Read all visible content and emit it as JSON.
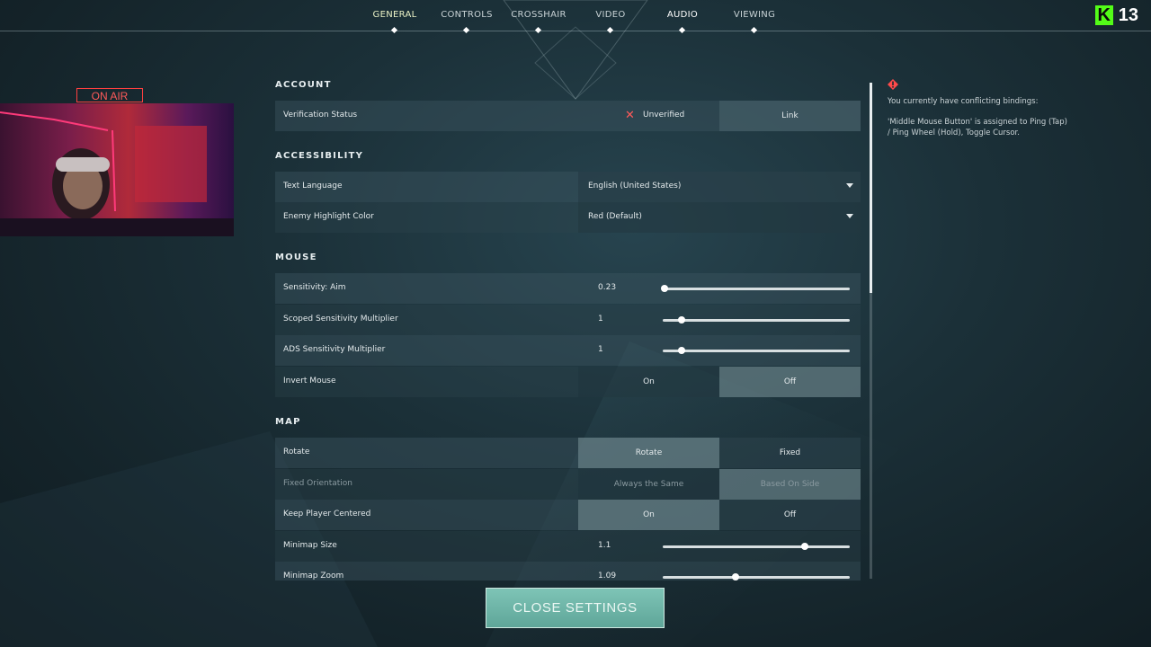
{
  "nav": {
    "tabs": [
      {
        "label": "GENERAL"
      },
      {
        "label": "CONTROLS"
      },
      {
        "label": "CROSSHAIR"
      },
      {
        "label": "VIDEO"
      },
      {
        "label": "AUDIO"
      },
      {
        "label": "VIEWING"
      }
    ],
    "active_tab": "GENERAL"
  },
  "brand": {
    "logo_letter": "K",
    "count": "13"
  },
  "overlay": {
    "on_air": "ON AIR"
  },
  "sections": {
    "account": "ACCOUNT",
    "accessibility": "ACCESSIBILITY",
    "mouse": "MOUSE",
    "map": "MAP"
  },
  "account": {
    "verification_label": "Verification Status",
    "verification_value": "Unverified",
    "link_label": "Link"
  },
  "accessibility": {
    "text_language_label": "Text Language",
    "text_language_value": "English (United States)",
    "enemy_color_label": "Enemy Highlight Color",
    "enemy_color_value": "Red (Default)"
  },
  "mouse": {
    "sens_aim_label": "Sensitivity: Aim",
    "sens_aim_value": "0.23",
    "sens_aim_fraction": 0.01,
    "scoped_label": "Scoped Sensitivity Multiplier",
    "scoped_value": "1",
    "scoped_fraction": 0.1,
    "ads_label": "ADS Sensitivity Multiplier",
    "ads_value": "1",
    "ads_fraction": 0.1,
    "invert_label": "Invert Mouse",
    "invert_on": "On",
    "invert_off": "Off",
    "invert_selected": "Off"
  },
  "map": {
    "rotate_label": "Rotate",
    "rotate_opt1": "Rotate",
    "rotate_opt2": "Fixed",
    "rotate_selected": "Rotate",
    "fixed_orient_label": "Fixed Orientation",
    "fixed_orient_opt1": "Always the Same",
    "fixed_orient_opt2": "Based On Side",
    "keep_centered_label": "Keep Player Centered",
    "keep_centered_on": "On",
    "keep_centered_off": "Off",
    "keep_centered_selected": "On",
    "minimap_size_label": "Minimap Size",
    "minimap_size_value": "1.1",
    "minimap_size_fraction": 0.76,
    "minimap_zoom_label": "Minimap Zoom",
    "minimap_zoom_value": "1.09",
    "minimap_zoom_fraction": 0.39
  },
  "warning": {
    "line1": "You currently have conflicting bindings:",
    "line2": "'Middle Mouse Button' is assigned to Ping (Tap) / Ping Wheel (Hold), Toggle Cursor."
  },
  "close_button": "CLOSE SETTINGS",
  "colors": {
    "accent": "#6fb5a7",
    "error": "#ff5a5a",
    "brand_green": "#53fc18"
  }
}
